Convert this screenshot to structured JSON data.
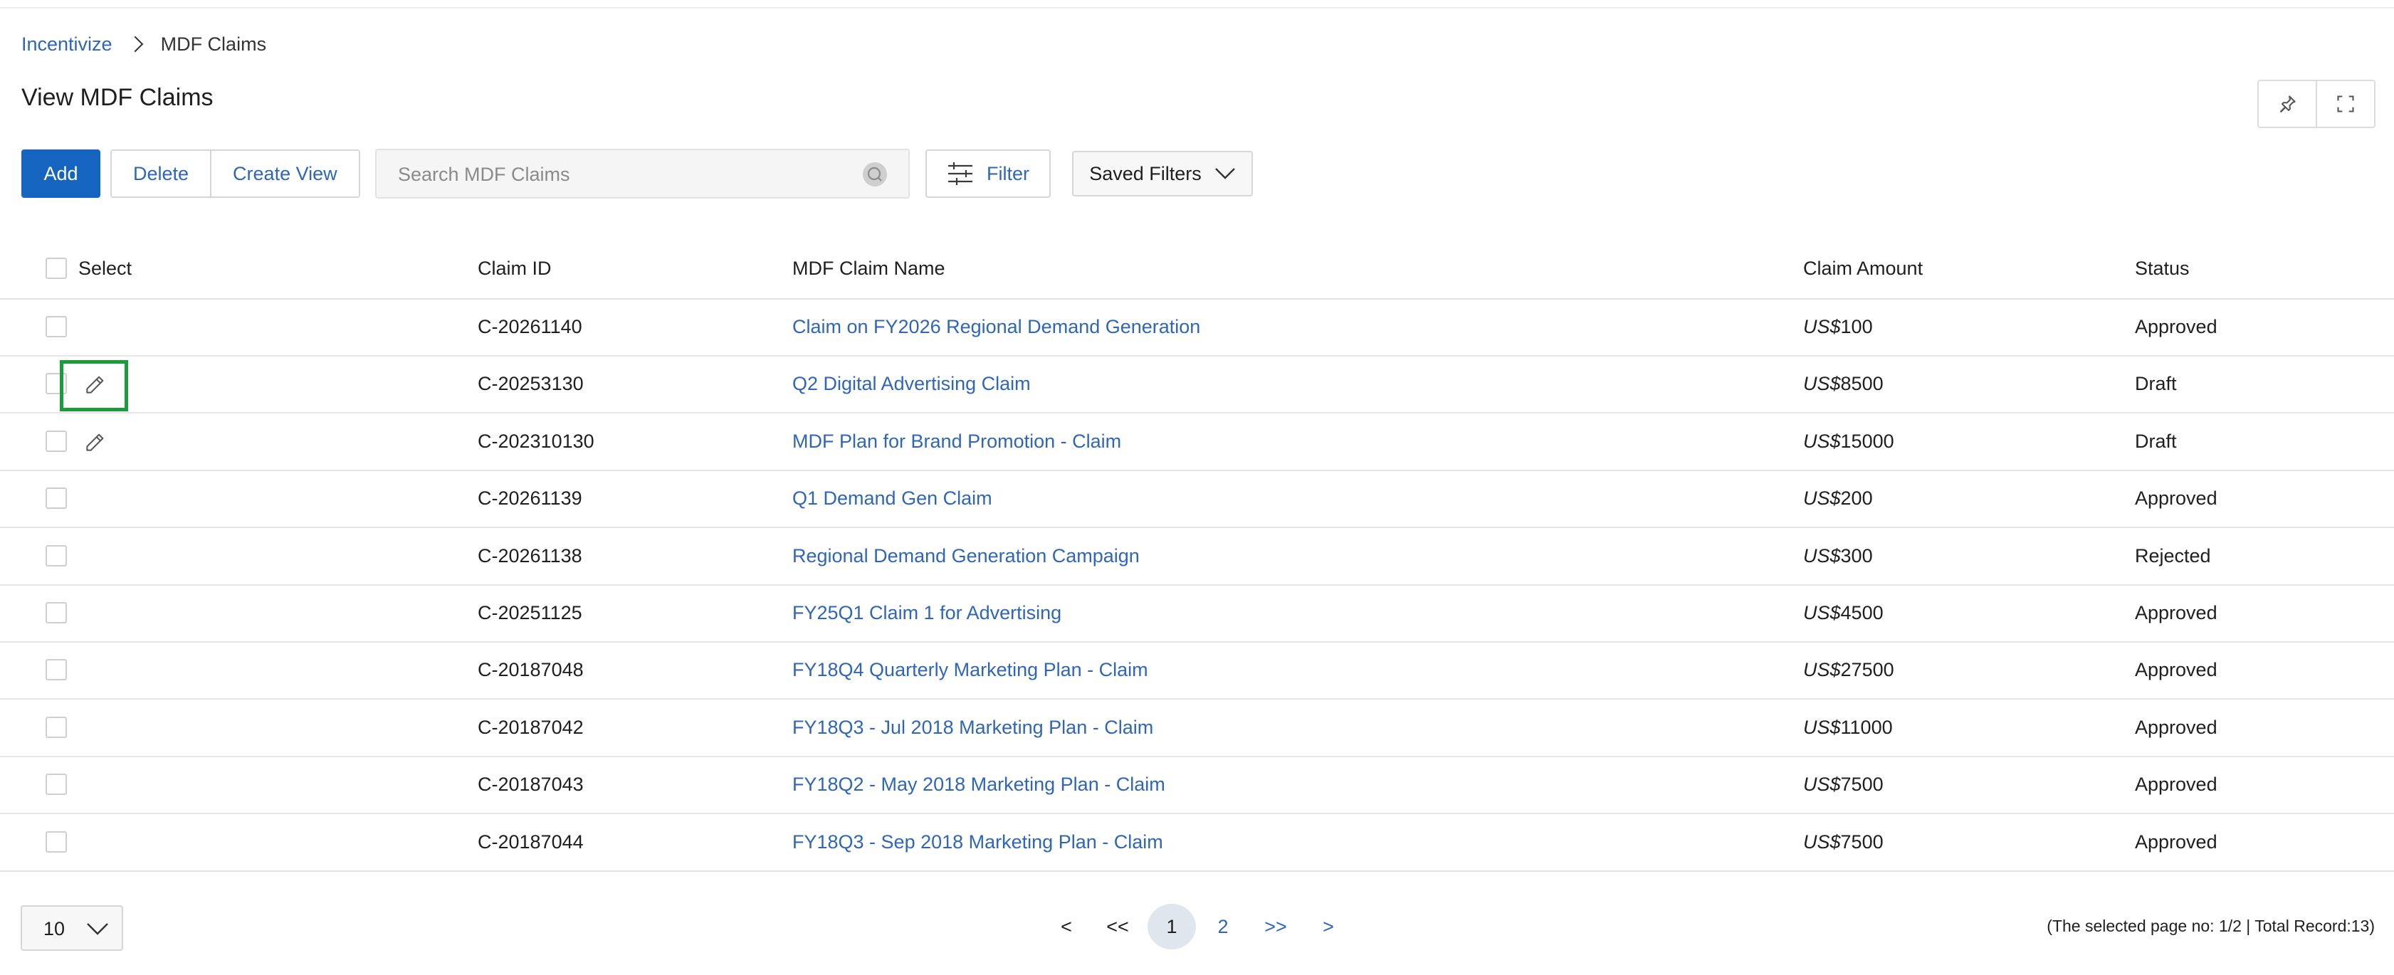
{
  "breadcrumb": {
    "root": "Incentivize",
    "current": "MDF Claims"
  },
  "page": {
    "title": "View MDF Claims"
  },
  "toolbar": {
    "add_label": "Add",
    "delete_label": "Delete",
    "create_view_label": "Create View",
    "search_placeholder": "Search MDF Claims",
    "search_value": "",
    "filter_label": "Filter",
    "saved_filters_label": "Saved Filters"
  },
  "table": {
    "columns": {
      "select": "Select",
      "claim_id": "Claim ID",
      "name": "MDF Claim Name",
      "amount": "Claim Amount",
      "status": "Status"
    },
    "currency": "US$",
    "rows": [
      {
        "id": "C-20261140",
        "name": "Claim on FY2026 Regional Demand Generation",
        "amount": "100",
        "status": "Approved",
        "editable": false
      },
      {
        "id": "C-20253130",
        "name": "Q2 Digital Advertising Claim",
        "amount": "8500",
        "status": "Draft",
        "editable": true
      },
      {
        "id": "C-202310130",
        "name": "MDF Plan for Brand Promotion - Claim",
        "amount": "15000",
        "status": "Draft",
        "editable": true
      },
      {
        "id": "C-20261139",
        "name": "Q1 Demand Gen Claim",
        "amount": "200",
        "status": "Approved",
        "editable": false
      },
      {
        "id": "C-20261138",
        "name": "Regional Demand Generation Campaign",
        "amount": "300",
        "status": "Rejected",
        "editable": false
      },
      {
        "id": "C-20251125",
        "name": "FY25Q1 Claim 1 for Advertising",
        "amount": "4500",
        "status": "Approved",
        "editable": false
      },
      {
        "id": "C-20187048",
        "name": "FY18Q4 Quarterly Marketing Plan - Claim",
        "amount": "27500",
        "status": "Approved",
        "editable": false
      },
      {
        "id": "C-20187042",
        "name": "FY18Q3 - Jul 2018 Marketing Plan - Claim",
        "amount": "11000",
        "status": "Approved",
        "editable": false
      },
      {
        "id": "C-20187043",
        "name": "FY18Q2 - May 2018 Marketing Plan - Claim",
        "amount": "7500",
        "status": "Approved",
        "editable": false
      },
      {
        "id": "C-20187044",
        "name": "FY18Q3 - Sep 2018 Marketing Plan - Claim",
        "amount": "7500",
        "status": "Approved",
        "editable": false
      }
    ]
  },
  "pagination": {
    "page_size": "10",
    "prev": "<",
    "first": "<<",
    "pages": [
      "1",
      "2"
    ],
    "last": ">>",
    "next": ">",
    "info": "(The selected page no: 1/2 | Total Record:13)"
  },
  "colors": {
    "primary": "#1565c0",
    "link": "#2f66b8",
    "focus": "#1a9b3c"
  }
}
